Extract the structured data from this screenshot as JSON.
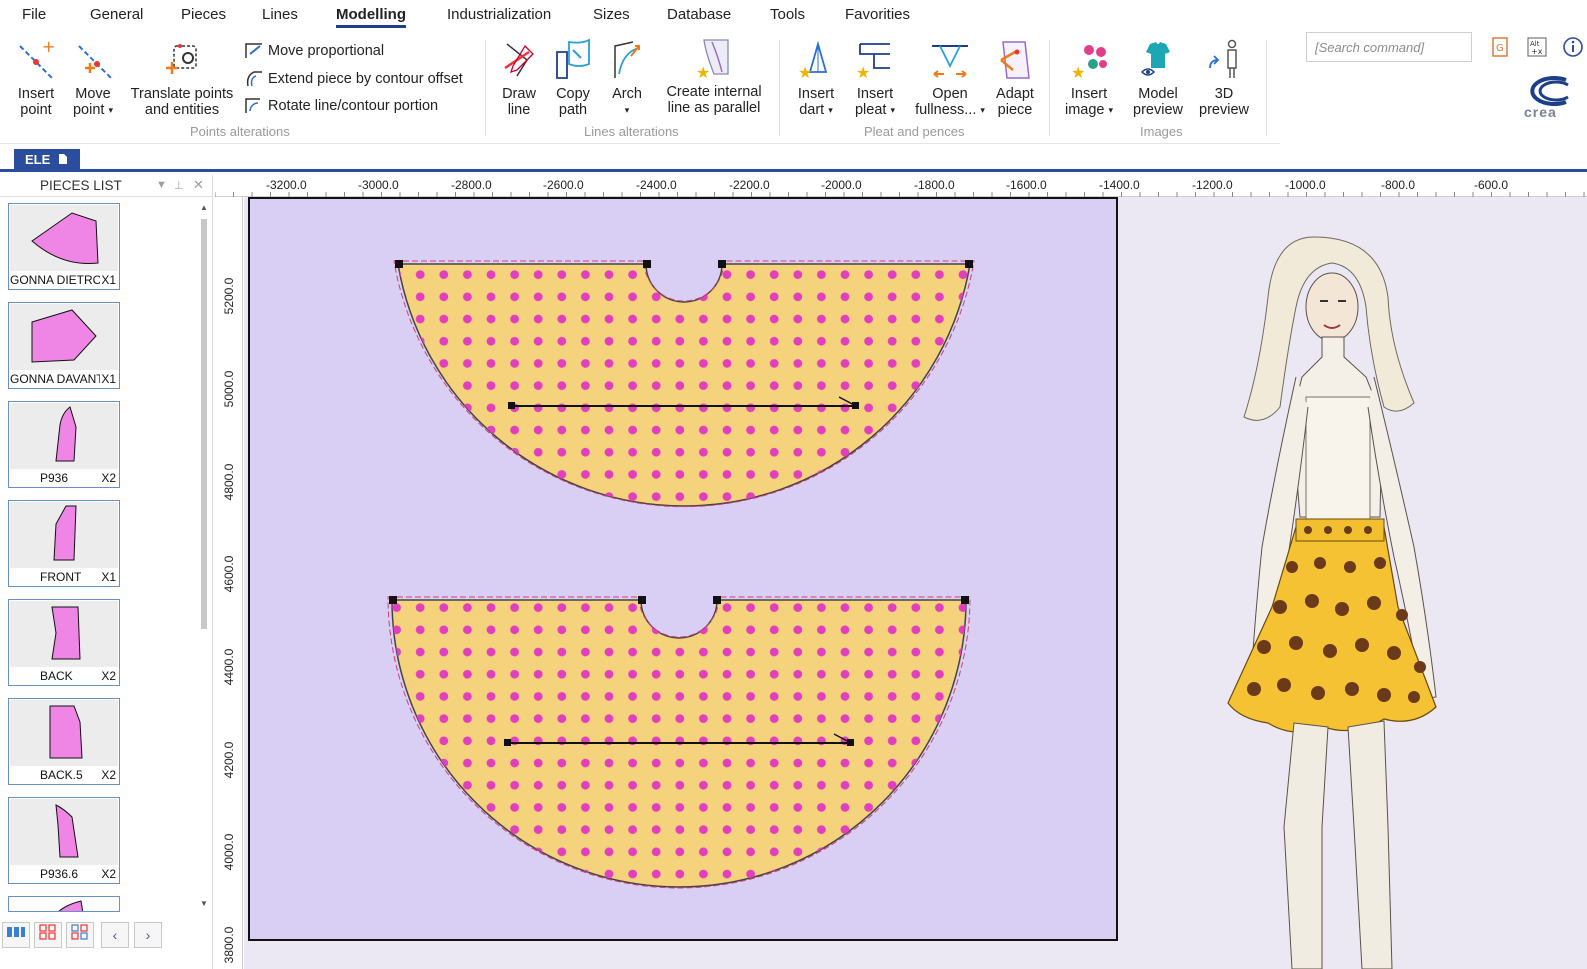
{
  "menu": {
    "items": [
      "File",
      "General",
      "Pieces",
      "Lines",
      "Modelling",
      "Industrialization",
      "Sizes",
      "Database",
      "Tools",
      "Favorities"
    ],
    "active": "Modelling"
  },
  "ribbon": {
    "points_group": {
      "label": "Points alterations",
      "insert_point": [
        "Insert",
        "point"
      ],
      "move_point": [
        "Move",
        "point"
      ],
      "translate": [
        "Translate points",
        "and entities"
      ],
      "move_proportional": "Move proportional",
      "extend_piece": "Extend piece by contour offset",
      "rotate_line": "Rotate line/contour portion"
    },
    "lines_group": {
      "label": "Lines alterations",
      "draw_line": [
        "Draw",
        "line"
      ],
      "copy_path": [
        "Copy",
        "path"
      ],
      "arch": "Arch",
      "create_internal": [
        "Create internal",
        "line as parallel"
      ]
    },
    "pleat_group": {
      "label": "Pleat and pences",
      "insert_dart": [
        "Insert",
        "dart"
      ],
      "insert_pleat": [
        "Insert",
        "pleat"
      ],
      "open_fullness": [
        "Open",
        "fullness..."
      ],
      "adapt_piece": [
        "Adapt",
        "piece"
      ]
    },
    "images_group": {
      "label": "Images",
      "insert_image": [
        "Insert",
        "image"
      ],
      "model_preview": [
        "Model",
        "preview"
      ],
      "preview_3d": [
        "3D",
        "preview"
      ]
    }
  },
  "search": {
    "placeholder": "[Search command]"
  },
  "logo_text": "crea",
  "doc_tab": {
    "label": "ELE"
  },
  "pieces_panel": {
    "title": "PIECES LIST",
    "pieces": [
      {
        "name": "GONNA DIETRO",
        "qty": "X1",
        "shape": "skirt-back"
      },
      {
        "name": "GONNA DAVANTI",
        "qty": "X1",
        "shape": "skirt-front"
      },
      {
        "name": "P936",
        "qty": "X2",
        "shape": "sleeve"
      },
      {
        "name": "FRONT",
        "qty": "X1",
        "shape": "front"
      },
      {
        "name": "BACK",
        "qty": "X2",
        "shape": "back"
      },
      {
        "name": "BACK.5",
        "qty": "X2",
        "shape": "back5"
      },
      {
        "name": "P936.6",
        "qty": "X2",
        "shape": "sleeve"
      }
    ]
  },
  "rulers": {
    "horizontal": [
      "-3200.0",
      "-3000.0",
      "-2800.0",
      "-2600.0",
      "-2400.0",
      "-2200.0",
      "-2000.0",
      "-1800.0",
      "-1600.0",
      "-1400.0",
      "-1200.0",
      "-1000.0",
      "-800.0",
      "-600.0"
    ],
    "vertical": [
      "5200.0",
      "5000.0",
      "4800.0",
      "4600.0",
      "4400.0",
      "4200.0",
      "4000.0",
      "3800.0"
    ]
  },
  "colors": {
    "accent": "#2a4d9e",
    "sheet": "#d9cff4",
    "piece_fill": "#f5d37c",
    "dot": "#e23fbf",
    "thumb_fill": "#ef86e6"
  }
}
